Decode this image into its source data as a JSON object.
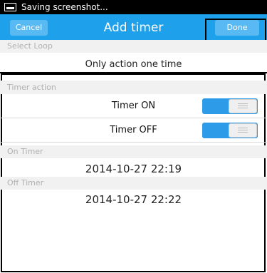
{
  "status_bar": {
    "text": "Saving screenshot...",
    "icon": "screenshot-icon"
  },
  "header": {
    "cancel_label": "Cancel",
    "title": "Add timer",
    "done_label": "Done"
  },
  "select_loop": {
    "header": "Select Loop",
    "value": "Only action one time"
  },
  "timer_action": {
    "header": "Timer action",
    "items": [
      {
        "label": "Timer ON",
        "enabled": true
      },
      {
        "label": "Timer OFF",
        "enabled": true
      }
    ]
  },
  "on_timer": {
    "header": "On Timer",
    "value": "2014-10-27 22:19"
  },
  "off_timer": {
    "header": "Off Timer",
    "value": "2014-10-27 22:22"
  },
  "colors": {
    "accent": "#1ea0ea",
    "toggle_on": "#2e9be8",
    "section_bg": "#f1f1f1",
    "section_text": "#b0b0b0"
  }
}
